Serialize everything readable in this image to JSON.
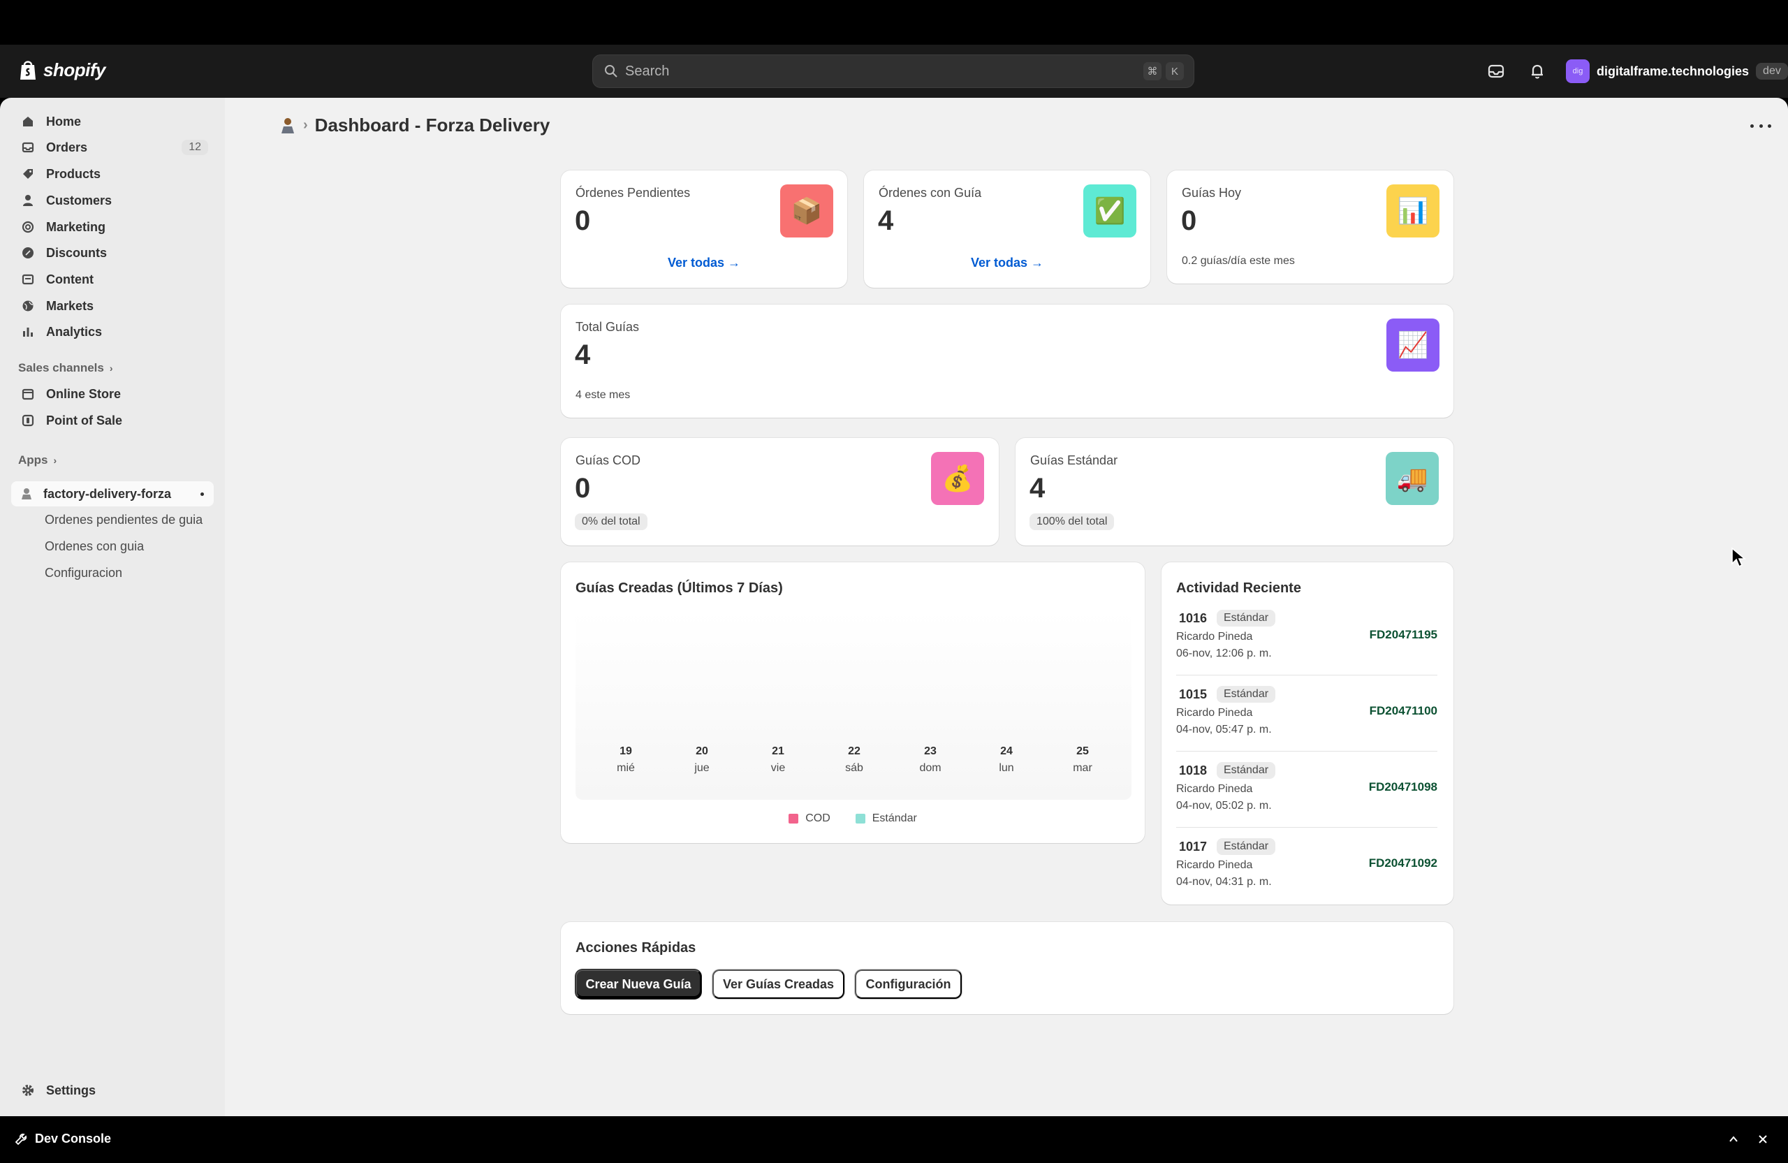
{
  "topbar": {
    "brand": "shopify",
    "search_placeholder": "Search",
    "shortcut_keys": [
      "⌘",
      "K"
    ],
    "account_initials": "dig",
    "account_name": "digitalframe.technologies",
    "account_tag": "dev"
  },
  "sidebar": {
    "items": [
      {
        "label": "Home",
        "icon": "home-icon"
      },
      {
        "label": "Orders",
        "icon": "orders-icon",
        "badge": "12"
      },
      {
        "label": "Products",
        "icon": "tag-icon"
      },
      {
        "label": "Customers",
        "icon": "person-icon"
      },
      {
        "label": "Marketing",
        "icon": "target-icon"
      },
      {
        "label": "Discounts",
        "icon": "discount-icon"
      },
      {
        "label": "Content",
        "icon": "content-icon"
      },
      {
        "label": "Markets",
        "icon": "globe-icon"
      },
      {
        "label": "Analytics",
        "icon": "bar-chart-icon"
      }
    ],
    "sales_channels_label": "Sales channels",
    "channels": [
      {
        "label": "Online Store",
        "icon": "store-icon"
      },
      {
        "label": "Point of Sale",
        "icon": "pos-icon"
      }
    ],
    "apps_label": "Apps",
    "app_name": "factory-delivery-forza",
    "app_subitems": [
      "Ordenes pendientes de guia",
      "Ordenes con guia",
      "Configuracion"
    ],
    "settings_label": "Settings"
  },
  "page": {
    "title": "Dashboard - Forza Delivery"
  },
  "stats": {
    "pendientes": {
      "label": "Órdenes Pendientes",
      "value": "0",
      "link": "Ver todas →",
      "icon": "📦"
    },
    "con_guia": {
      "label": "Órdenes con Guía",
      "value": "4",
      "link": "Ver todas →",
      "icon": "✅"
    },
    "hoy": {
      "label": "Guías Hoy",
      "value": "0",
      "sub": "0.2 guías/día este mes",
      "icon": "📊"
    },
    "total": {
      "label": "Total Guías",
      "value": "4",
      "sub": "4 este mes",
      "icon": "📈"
    },
    "cod": {
      "label": "Guías COD",
      "value": "0",
      "pill": "0% del total",
      "icon": "💰"
    },
    "estandar": {
      "label": "Guías Estándar",
      "value": "4",
      "pill": "100% del total",
      "icon": "🚚"
    }
  },
  "chart_data": {
    "type": "bar",
    "title": "Guías Creadas (Últimos 7 Días)",
    "categories": [
      {
        "day": "19",
        "weekday": "mié"
      },
      {
        "day": "20",
        "weekday": "jue"
      },
      {
        "day": "21",
        "weekday": "vie"
      },
      {
        "day": "22",
        "weekday": "sáb"
      },
      {
        "day": "23",
        "weekday": "dom"
      },
      {
        "day": "24",
        "weekday": "lun"
      },
      {
        "day": "25",
        "weekday": "mar"
      }
    ],
    "series": [
      {
        "name": "COD",
        "color": "#f2638c",
        "values": [
          0,
          0,
          0,
          0,
          0,
          0,
          0
        ]
      },
      {
        "name": "Estándar",
        "color": "#8ee0d6",
        "values": [
          0,
          0,
          0,
          0,
          0,
          0,
          0
        ]
      }
    ],
    "legend": "bottom"
  },
  "activity": {
    "title": "Actividad Reciente",
    "items": [
      {
        "order": "1016",
        "type": "Estándar",
        "customer": "Ricardo Pineda",
        "time": "06-nov, 12:06 p. m.",
        "code": "FD20471195"
      },
      {
        "order": "1015",
        "type": "Estándar",
        "customer": "Ricardo Pineda",
        "time": "04-nov, 05:47 p. m.",
        "code": "FD20471100"
      },
      {
        "order": "1018",
        "type": "Estándar",
        "customer": "Ricardo Pineda",
        "time": "04-nov, 05:02 p. m.",
        "code": "FD20471098"
      },
      {
        "order": "1017",
        "type": "Estándar",
        "customer": "Ricardo Pineda",
        "time": "04-nov, 04:31 p. m.",
        "code": "FD20471092"
      }
    ]
  },
  "quick_actions": {
    "title": "Acciones Rápidas",
    "create": "Crear Nueva Guía",
    "view": "Ver Guías Creadas",
    "config": "Configuración"
  },
  "dev_console": {
    "label": "Dev Console"
  },
  "colors": {
    "tile_pendientes": "#f87171",
    "tile_con_guia": "#5eead4",
    "tile_hoy": "#fcd34d",
    "tile_total": "#8b5cf6",
    "tile_cod": "#f472b6",
    "tile_estandar": "#7dd3c8",
    "link": "#005bd3",
    "code_green": "#0c5132"
  }
}
